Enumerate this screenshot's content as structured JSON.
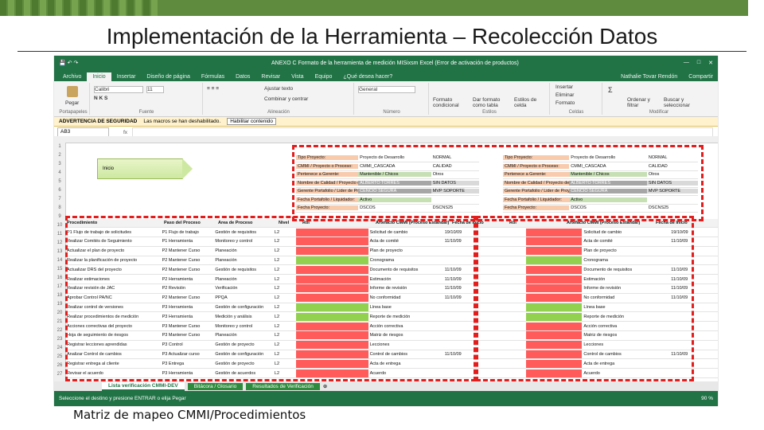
{
  "slide": {
    "title": "Implementación de la Herramienta – Recolección Datos",
    "caption": "Matriz de mapeo CMMI/Procedimientos"
  },
  "excel": {
    "window_title": "ANEXO C  Formato de la herramienta de medición MISixsm   Excel (Error de activación de productos)",
    "window_controls": [
      "—",
      "□",
      "✕"
    ],
    "tabs": [
      "Archivo",
      "Inicio",
      "Insertar",
      "Diseño de página",
      "Fórmulas",
      "Datos",
      "Revisar",
      "Vista",
      "Equipo",
      "¿Qué desea hacer?"
    ],
    "active_tab": "Inicio",
    "user": "Nathalie Tovar Rendón",
    "share": "Compartir",
    "ribbon": {
      "paste": "Pegar",
      "font_name": "Calibri",
      "font_size": "11",
      "wrap": "Ajustar texto",
      "merge": "Combinar y centrar",
      "number_format": "General",
      "conditional": "Formato condicional",
      "format_table": "Dar formato como tabla",
      "cell_styles": "Estilos de celda",
      "insert": "Insertar",
      "delete": "Eliminar",
      "format": "Formato",
      "sort": "Ordenar y filtrar",
      "find": "Buscar y seleccionar",
      "groups": [
        "Portapapeles",
        "Fuente",
        "Alineación",
        "Número",
        "Estilos",
        "Celdas",
        "Modificar"
      ]
    },
    "security_warning": {
      "label": "ADVERTENCIA DE SEGURIDAD",
      "text": "Las macros se han deshabilitado.",
      "button": "Habilitar contenido"
    },
    "name_box": "AB3",
    "fx": "fx",
    "row_numbers": [
      "1",
      "2",
      "3",
      "4",
      "5",
      "6",
      "7",
      "8",
      "9",
      "10",
      "11",
      "12",
      "13",
      "14",
      "15",
      "16",
      "17",
      "18",
      "19",
      "20",
      "21",
      "22",
      "23",
      "24",
      "25",
      "26",
      "27"
    ],
    "shape_label": "Inicio",
    "header_blocks": [
      {
        "rows": [
          [
            "Tipo Proyecto:",
            "Proyecto de Desarrollo",
            "NORMAL"
          ],
          [
            "CMMI / Proyecto o Proceso:",
            "CMMI_CASCADA",
            "CALIDAD"
          ],
          [
            "Pertenece a Gerente:",
            "Mantenible / Chicos",
            "Otros"
          ],
          [
            "Nombre de Calidad / Proyecto de Sistema:",
            "ALBERTO TORRES",
            "SIN DATOS"
          ],
          [
            "Gerente Portafolio / Lider de Proyecto:",
            "CENCIO SEGURA",
            "MVP SOPORTE"
          ],
          [
            "Fecha Portafolio / Liquidador:",
            "Activo",
            ""
          ],
          [
            "Fecha Proyecto:",
            "DSCOS",
            "DSCNS25"
          ]
        ]
      },
      {
        "rows": [
          [
            "Tipo Proyecto:",
            "Proyecto de Desarrollo",
            "NORMAL"
          ],
          [
            "CMMI / Proyecto o Proceso:",
            "CMMI_CASCADA",
            "CALIDAD"
          ],
          [
            "Pertenece a Gerente:",
            "Mantenible / Chicos",
            "Otros"
          ],
          [
            "Nombre de Calidad / Proyecto de Sistema:",
            "ALBERTO TORRES",
            "SIN DATOS"
          ],
          [
            "Gerente Portafolio / Lider de Proyecto:",
            "CENCIO SEGURA",
            "MVP SOPORTE"
          ],
          [
            "Fecha Portafolio / Liquidador:",
            "Activo",
            ""
          ],
          [
            "Fecha Proyecto:",
            "DSCOS",
            "DSCNS25"
          ]
        ]
      }
    ],
    "table_headers": [
      "Procedimiento",
      "Paso del Proceso",
      "Área de Proceso",
      "Nivel",
      "Rol",
      "Artefacto CMMI (Proceso Estándar)",
      "Fecha de Inicio"
    ],
    "table_rows": [
      {
        "proc": "P1 Flujo de trabajo de solicitudes",
        "paso": "P1 Flujo de trabajo",
        "area": "Gestión de requisitos",
        "nivel": "L2",
        "ok": false,
        "art": "Solicitud de cambio",
        "fecha": "19/10/09"
      },
      {
        "proc": "Realizar Comités de Seguimiento",
        "paso": "P1 Herramienta",
        "area": "Monitoreo y control",
        "nivel": "L2",
        "ok": false,
        "art": "Acta de comité",
        "fecha": "11/10/09"
      },
      {
        "proc": "Actualizar el plan de proyecto",
        "paso": "P2 Mantener Curso",
        "area": "Planeación",
        "nivel": "L2",
        "ok": false,
        "art": "Plan de proyecto",
        "fecha": ""
      },
      {
        "proc": "Realizar la planificación de proyecto",
        "paso": "P2 Mantener Curso",
        "area": "Planeación",
        "nivel": "L2",
        "ok": true,
        "art": "Cronograma",
        "fecha": ""
      },
      {
        "proc": "Actualizar DRS del proyecto",
        "paso": "P2 Mantener Curso",
        "area": "Gestión de requisitos",
        "nivel": "L2",
        "ok": false,
        "art": "Documento de requisitos",
        "fecha": "11/10/09"
      },
      {
        "proc": "Realizar estimaciones",
        "paso": "P2 Herramienta",
        "area": "Planeación",
        "nivel": "L2",
        "ok": false,
        "art": "Estimación",
        "fecha": "11/10/09"
      },
      {
        "proc": "Realizar revisión de JAC",
        "paso": "P2 Revisión",
        "area": "Verificación",
        "nivel": "L2",
        "ok": false,
        "art": "Informe de revisión",
        "fecha": "11/10/09"
      },
      {
        "proc": "Aprobar Control PA/NC",
        "paso": "P2 Mantener Curso",
        "area": "PPQA",
        "nivel": "L2",
        "ok": false,
        "art": "No conformidad",
        "fecha": "11/10/09"
      },
      {
        "proc": "Realizar control de versiones",
        "paso": "P3 Herramienta",
        "area": "Gestión de configuración",
        "nivel": "L2",
        "ok": true,
        "art": "Línea base",
        "fecha": ""
      },
      {
        "proc": "Realizar procedimientos de medición",
        "paso": "P3 Herramienta",
        "area": "Medición y análisis",
        "nivel": "L2",
        "ok": true,
        "art": "Reporte de medición",
        "fecha": ""
      },
      {
        "proc": "Acciones correctivas del proyecto",
        "paso": "P3 Mantener Curso",
        "area": "Monitoreo y control",
        "nivel": "L2",
        "ok": false,
        "art": "Acción correctiva",
        "fecha": ""
      },
      {
        "proc": "Hoja de seguimiento de riesgos",
        "paso": "P3 Mantener Curso",
        "area": "Planeación",
        "nivel": "L2",
        "ok": false,
        "art": "Matriz de riesgos",
        "fecha": ""
      },
      {
        "proc": "Registrar lecciones aprendidas",
        "paso": "P3 Control",
        "area": "Gestión de proyecto",
        "nivel": "L2",
        "ok": false,
        "art": "Lecciones",
        "fecha": ""
      },
      {
        "proc": "Analizar Control de cambios",
        "paso": "P3 Actualizar curso",
        "area": "Gestión de configuración",
        "nivel": "L2",
        "ok": false,
        "art": "Control de cambios",
        "fecha": "11/10/09"
      },
      {
        "proc": "Registrar entrega al cliente",
        "paso": "P3 Entrega",
        "area": "Gestión de proyecto",
        "nivel": "L2",
        "ok": false,
        "art": "Acta de entrega",
        "fecha": ""
      },
      {
        "proc": "Revisar el acuerdo",
        "paso": "P3 Herramienta",
        "area": "Gestión de acuerdos",
        "nivel": "L2",
        "ok": false,
        "art": "Acuerdo",
        "fecha": ""
      }
    ],
    "sheet_tabs": [
      "Lista verificación CMMI-DEV",
      "Bitácora / Glosario",
      "Resultados de Verificación"
    ],
    "active_sheet": "Lista verificación CMMI-DEV",
    "status_left": "Seleccione el destino y presione ENTRAR o elija Pegar",
    "status_right": "90 %",
    "colors": {
      "excel_green": "#217346",
      "ok": "#92d050",
      "fail": "#ff5b5b",
      "dash": "#e31c1c",
      "orange_cell": "#f8cbad",
      "gray_cell": "#a6a6a6"
    }
  }
}
